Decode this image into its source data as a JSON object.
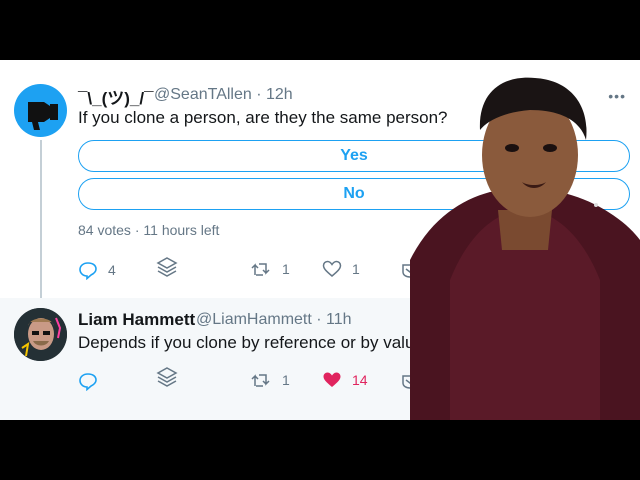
{
  "tweet1": {
    "name": "¯\\_(ツ)_/¯",
    "handle": "@SeanTAllen",
    "time": "12h",
    "text": "If you clone a person, are they the same person?",
    "poll": {
      "options": [
        "Yes",
        "No"
      ],
      "votes": "84 votes",
      "time_left": "11 hours left"
    },
    "actions": {
      "reply_count": "4",
      "retweet_count": "1",
      "like_count": "1"
    }
  },
  "tweet2": {
    "name": "Liam Hammett",
    "handle": "@LiamHammett",
    "time": "11h",
    "text": "Depends if you clone by reference or by value",
    "actions": {
      "retweet_count": "1",
      "like_count": "14"
    }
  },
  "colors": {
    "accent": "#1da1f2",
    "like": "#e0245e",
    "text": "#14171a",
    "muted": "#657786"
  }
}
